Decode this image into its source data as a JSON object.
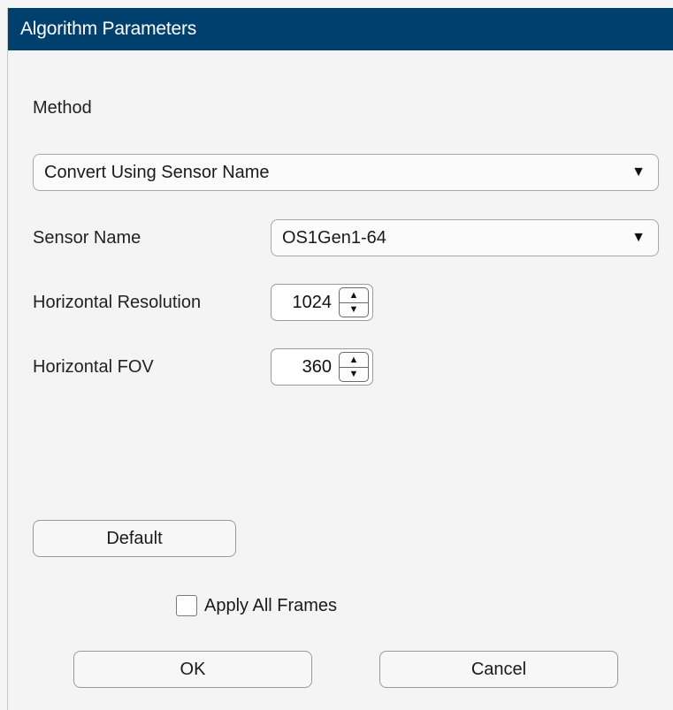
{
  "dialog": {
    "title": "Algorithm Parameters"
  },
  "method": {
    "label": "Method",
    "selected": "Convert Using Sensor Name",
    "arrow": "▼"
  },
  "sensor_name": {
    "label": "Sensor Name",
    "selected": "OS1Gen1-64",
    "arrow": "▼"
  },
  "horizontal_resolution": {
    "label": "Horizontal Resolution",
    "value": "1024",
    "up": "▲",
    "down": "▼"
  },
  "horizontal_fov": {
    "label": "Horizontal FOV",
    "value": "360",
    "up": "▲",
    "down": "▼"
  },
  "buttons": {
    "default_label": "Default",
    "ok_label": "OK",
    "cancel_label": "Cancel"
  },
  "apply_all_frames": {
    "label": "Apply All Frames",
    "checked": false
  },
  "colors": {
    "titlebar": "#00406e",
    "background": "#f4f4f4"
  }
}
